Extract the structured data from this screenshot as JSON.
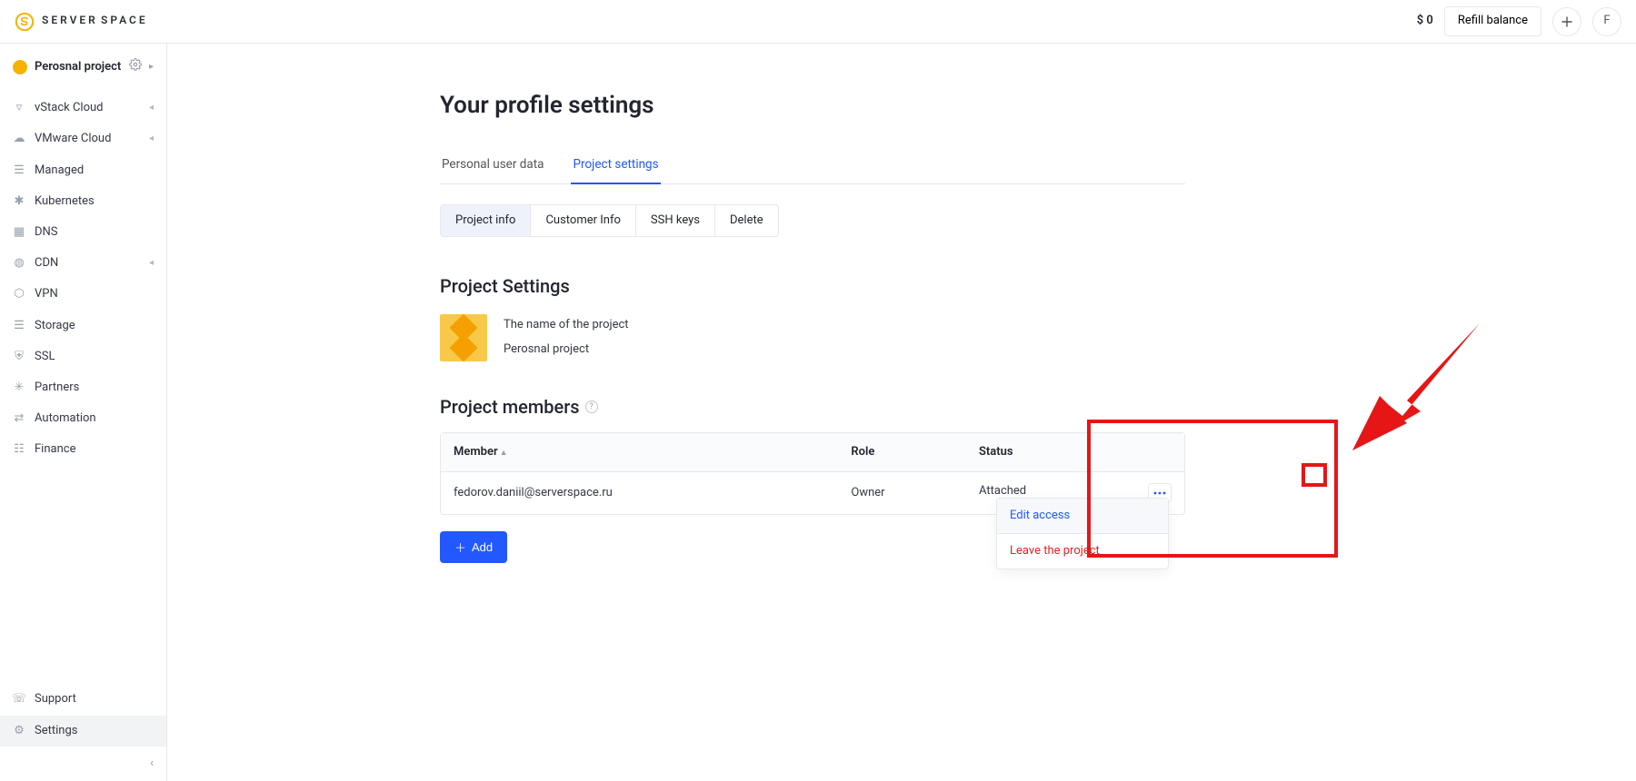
{
  "header": {
    "balance": "$ 0",
    "refill_label": "Refill balance",
    "avatar_initial": "F",
    "logo_main": "SERVER",
    "logo_sub": "SPACE"
  },
  "project": {
    "name": "Perosnal project"
  },
  "sidebar": {
    "items": [
      {
        "label": "vStack Cloud",
        "expandable": true
      },
      {
        "label": "VMware Cloud",
        "expandable": true
      },
      {
        "label": "Managed",
        "expandable": false
      },
      {
        "label": "Kubernetes",
        "expandable": false
      },
      {
        "label": "DNS",
        "expandable": false
      },
      {
        "label": "CDN",
        "expandable": true
      },
      {
        "label": "VPN",
        "expandable": false
      },
      {
        "label": "Storage",
        "expandable": false
      },
      {
        "label": "SSL",
        "expandable": false
      },
      {
        "label": "Partners",
        "expandable": false
      },
      {
        "label": "Automation",
        "expandable": false
      },
      {
        "label": "Finance",
        "expandable": false
      }
    ],
    "bottom": [
      {
        "label": "Support"
      },
      {
        "label": "Settings"
      }
    ]
  },
  "page": {
    "title": "Your profile settings",
    "tabs": [
      {
        "label": "Personal user data",
        "active": false
      },
      {
        "label": "Project settings",
        "active": true
      }
    ],
    "subtabs": [
      {
        "label": "Project info",
        "active": true
      },
      {
        "label": "Customer Info",
        "active": false
      },
      {
        "label": "SSH keys",
        "active": false
      },
      {
        "label": "Delete",
        "active": false
      }
    ],
    "project_settings_heading": "Project Settings",
    "project_name_label": "The name of the project",
    "project_name_value": "Perosnal project",
    "members_heading": "Project members",
    "add_label": "Add",
    "table": {
      "columns": [
        "Member",
        "Role",
        "Status"
      ],
      "rows": [
        {
          "member": "fedorov.daniil@serverspace.ru",
          "role": "Owner",
          "status": "Attached"
        }
      ]
    },
    "row_menu": {
      "edit_label": "Edit access",
      "leave_label": "Leave the project"
    }
  }
}
